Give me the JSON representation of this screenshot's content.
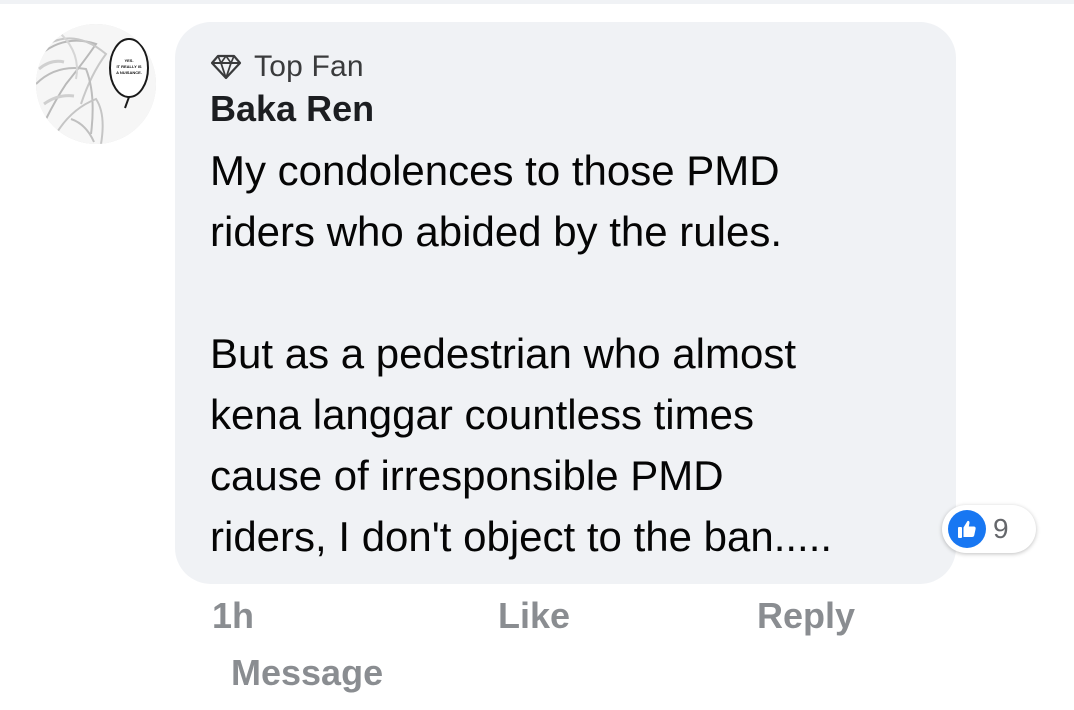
{
  "comment": {
    "badge": {
      "icon": "diamond-icon",
      "label": "Top Fan"
    },
    "author": "Baka Ren",
    "avatar": {
      "icon": "anime-avatar-image",
      "speech_bubble_text": "YES. IT REALLY IS A NUISANCE."
    },
    "body_lines": [
      "My condolences to those PMD",
      "riders who abided by the rules.",
      "But as a pedestrian who almost",
      "kena langgar countless times",
      "cause of irresponsible PMD",
      "riders, I don't object to the ban....."
    ],
    "reactions": {
      "icon": "thumbs-up-icon",
      "count": "9",
      "color": "#1877f2"
    }
  },
  "actions": {
    "time": "1h",
    "like": "Like",
    "reply": "Reply",
    "message": "Message"
  },
  "colors": {
    "bubble_background": "#f0f2f5",
    "action_text": "#8a8d91",
    "body_text": "#050505"
  }
}
